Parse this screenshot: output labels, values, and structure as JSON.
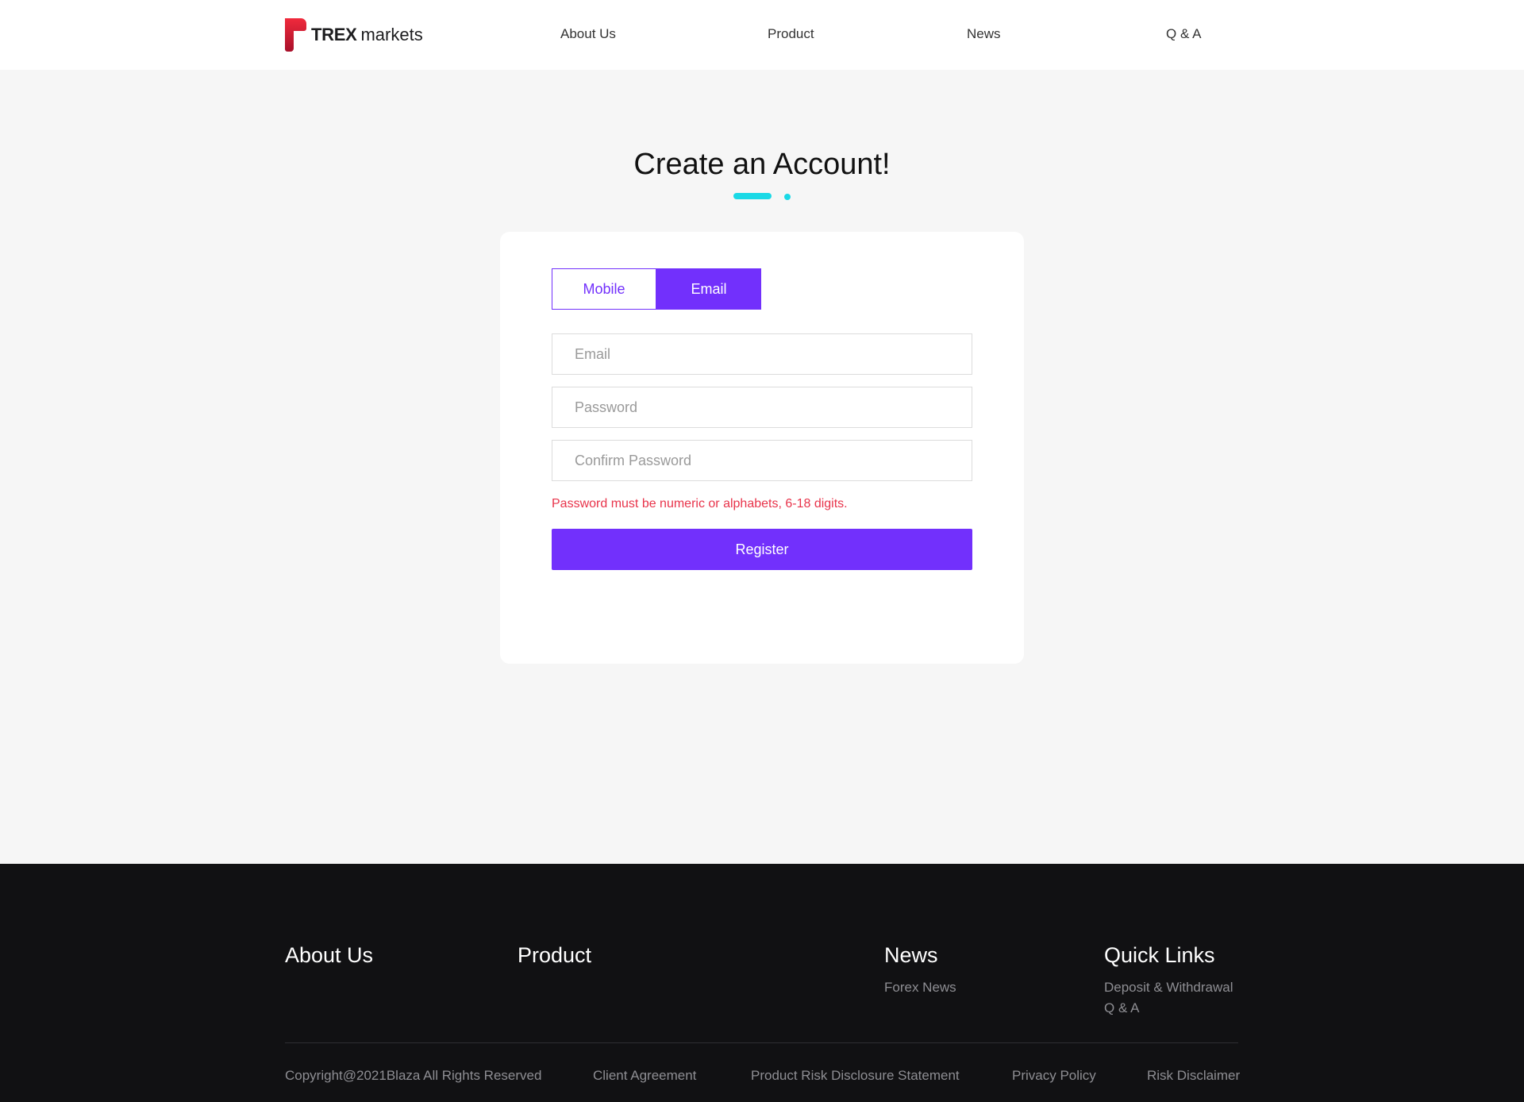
{
  "brand": {
    "name_bold": "TREX",
    "name_light": "markets",
    "logo_color_top": "#f02a3c",
    "logo_color_bottom": "#a8102a"
  },
  "nav": {
    "items": [
      {
        "label": "About Us"
      },
      {
        "label": "Product"
      },
      {
        "label": "News"
      },
      {
        "label": "Q & A"
      }
    ]
  },
  "page": {
    "title": "Create an Account!",
    "accent_color": "#1ad9e6"
  },
  "form": {
    "tabs": [
      {
        "label": "Mobile",
        "selected": false
      },
      {
        "label": "Email",
        "selected": true
      }
    ],
    "fields": {
      "email": {
        "value": "",
        "placeholder": "Email"
      },
      "password": {
        "value": "",
        "placeholder": "Password"
      },
      "confirm_password": {
        "value": "",
        "placeholder": "Confirm Password"
      }
    },
    "hint": "Password must be numeric or alphabets, 6-18 digits.",
    "hint_color": "#e8334a",
    "submit_label": "Register",
    "primary_color": "#7230fc"
  },
  "footer": {
    "columns": [
      {
        "heading": "About Us",
        "links": []
      },
      {
        "heading": "Product",
        "links": []
      },
      {
        "heading": "News",
        "links": [
          "Forex News"
        ]
      },
      {
        "heading": "Quick Links",
        "links": [
          "Deposit & Withdrawal",
          "Q & A"
        ]
      }
    ],
    "copyright": "Copyright@2021Blaza All Rights Reserved",
    "legal_links": [
      "Client Agreement",
      "Product Risk Disclosure Statement",
      "Privacy Policy",
      "Risk Disclaimer"
    ]
  }
}
